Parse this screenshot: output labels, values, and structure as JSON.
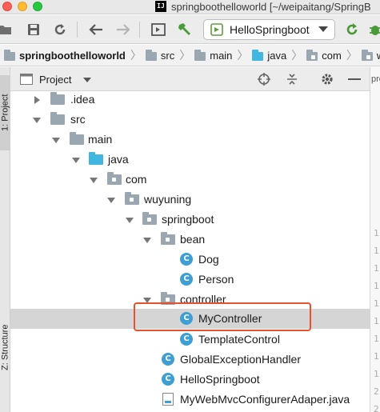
{
  "window": {
    "title": "springboothelloworld [~/weipaitang/SpringB",
    "logo_text": "IJ"
  },
  "toolbar": {
    "run_config_label": "HelloSpringboot"
  },
  "breadcrumb": [
    "springboothelloworld",
    "src",
    "main",
    "java",
    "com",
    "w"
  ],
  "left_tabs": {
    "project": "1: Project",
    "structure": "Z: Structure"
  },
  "pane": {
    "title": "Project"
  },
  "tree": [
    {
      "label": ".idea",
      "icon": "folder-icon",
      "expanded": false
    },
    {
      "label": "src",
      "icon": "folder-icon",
      "expanded": true
    },
    {
      "label": "main",
      "icon": "folder-icon",
      "expanded": true
    },
    {
      "label": "java",
      "icon": "source-folder-icon",
      "expanded": true
    },
    {
      "label": "com",
      "icon": "package-icon",
      "expanded": true
    },
    {
      "label": "wuyuning",
      "icon": "package-icon",
      "expanded": true
    },
    {
      "label": "springboot",
      "icon": "package-icon",
      "expanded": true
    },
    {
      "label": "bean",
      "icon": "package-icon",
      "expanded": true
    },
    {
      "label": "Dog",
      "icon": "class-icon"
    },
    {
      "label": "Person",
      "icon": "class-icon"
    },
    {
      "label": "controller",
      "icon": "package-icon",
      "expanded": true
    },
    {
      "label": "MyController",
      "icon": "class-icon",
      "selected": true
    },
    {
      "label": "TemplateControl",
      "icon": "class-icon"
    },
    {
      "label": "GlobalExceptionHandler",
      "icon": "class-icon"
    },
    {
      "label": "HelloSpringboot",
      "icon": "spring-boot-class-icon"
    },
    {
      "label": "MyWebMvcConfigurerAdaper.java",
      "icon": "java-file-icon"
    }
  ],
  "class_icon_letter": "C",
  "editor": {
    "tab_text": "pro",
    "line_numbers": [
      "1",
      "1",
      "1",
      "1",
      "1",
      "1",
      "1",
      "1",
      "1",
      "2",
      "2"
    ]
  },
  "colors": {
    "highlight_border": "#e6512e",
    "selection": "#d5d5d5",
    "class_icon": "#3d9fd3",
    "source_folder": "#40b6e0",
    "folder": "#9aa7b0"
  }
}
